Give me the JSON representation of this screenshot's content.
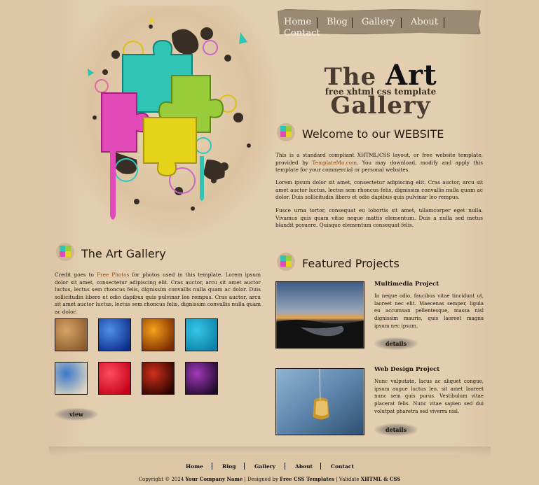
{
  "nav": {
    "items": [
      {
        "label": "Home"
      },
      {
        "label": "Blog"
      },
      {
        "label": "Gallery"
      },
      {
        "label": "About"
      },
      {
        "label": "Contact"
      }
    ]
  },
  "logo": {
    "title_the": "The",
    "title_art": "Art",
    "title_gallery": "Gallery",
    "subtitle": "free xhtml css template"
  },
  "welcome": {
    "title": "Welcome to our WEBSITE",
    "p1_before": "This is a standard compliant XHTML/CSS layout, or free website template, provided by ",
    "p1_link": "TemplateMo.com",
    "p1_after": ". You may download, modify and apply this template for your commercial or personal websites.",
    "p2": "Lorem ipsum dolor sit amet, consectetur adipiscing elit. Cras auctor, arcu sit amet auctor luctus, lectus sem rhoncus felis, dignissim convallis nulla quam ac dolor. Duis sollicitudin libero et odio dapibus quis pulvinar leo rempus.",
    "p3": "Fusce urna tortor, consequat eu lobortis sit amet, ullamcorper eget nulla. Vivamus quis quam vitae neque mattis elementum. Duis a nulla sed metus blandit posuere. Quisque elementum consequat felis."
  },
  "gallery": {
    "title": "The Art Gallery",
    "text_before": "Credit goes to ",
    "text_link": "Free Photos",
    "text_after": " for photos used in this template. Lorem ipsum dolor sit amet, consectetur adipiscing elit. Cras auctor, arcu sit amet auctor luctus, lectus sem rhoncus felis, dignissim convallis nulla quam ac dolor. Duis sollicitudin libero et odio dapibus quis pulvinar leo rempus. Cras auctor, arcu sit amet auctor luctus, lectus sem rhoncus felis, dignissim convallis nulla quam ac dolor.",
    "view_label": "view",
    "thumbs": [
      {
        "name": "thumb-pencils-wood",
        "color_a": "#8c5a2e",
        "color_b": "#d7a465"
      },
      {
        "name": "thumb-blue-glass",
        "color_a": "#0c2e8a",
        "color_b": "#4f8fe8"
      },
      {
        "name": "thumb-orange-fire",
        "color_a": "#7a2a00",
        "color_b": "#f5a21a"
      },
      {
        "name": "thumb-water-drops",
        "color_a": "#0b7fa6",
        "color_b": "#35c7e8"
      },
      {
        "name": "thumb-colored-pencils",
        "color_a": "#e0d7c2",
        "color_b": "#3a78c9"
      },
      {
        "name": "thumb-red-heart",
        "color_a": "#c4001a",
        "color_b": "#ff4d5e"
      },
      {
        "name": "thumb-red-lights",
        "color_a": "#2a0400",
        "color_b": "#d0301a"
      },
      {
        "name": "thumb-purple-lights",
        "color_a": "#1e0a2c",
        "color_b": "#a238b8"
      }
    ]
  },
  "featured": {
    "title": "Featured Projects",
    "projects": [
      {
        "title": "Multimedia Project",
        "text": "In neque odio, faucibus vitae tincidunt ut, laoreet nec elit. Maecenas semper, ligula eu accumsan pellentesque, massa nisl dignissim mauris, quis laoreet magna ipsum nec ipsum.",
        "details_label": "details"
      },
      {
        "title": "Web Design Project",
        "text": "Nunc vulputate, lacus ac aliquet congue, ipsum augue luctus leo, sit amet laoreet nunc sem quis purus. Vestibulum vitae placerat felis. Nunc vitae sapien sed dui volutpat pharetra sed viverra nisl.",
        "details_label": "details"
      }
    ]
  },
  "footer": {
    "links": [
      "Home",
      "Blog",
      "Gallery",
      "About",
      "Contact"
    ],
    "copy_prefix": "Copyright © 2024 ",
    "company": "Your Company Name",
    "designed_by": " | Designed by ",
    "designer": "Free CSS Templates",
    "validate_sep": " | Validate ",
    "validate": "XHTML & CSS"
  }
}
